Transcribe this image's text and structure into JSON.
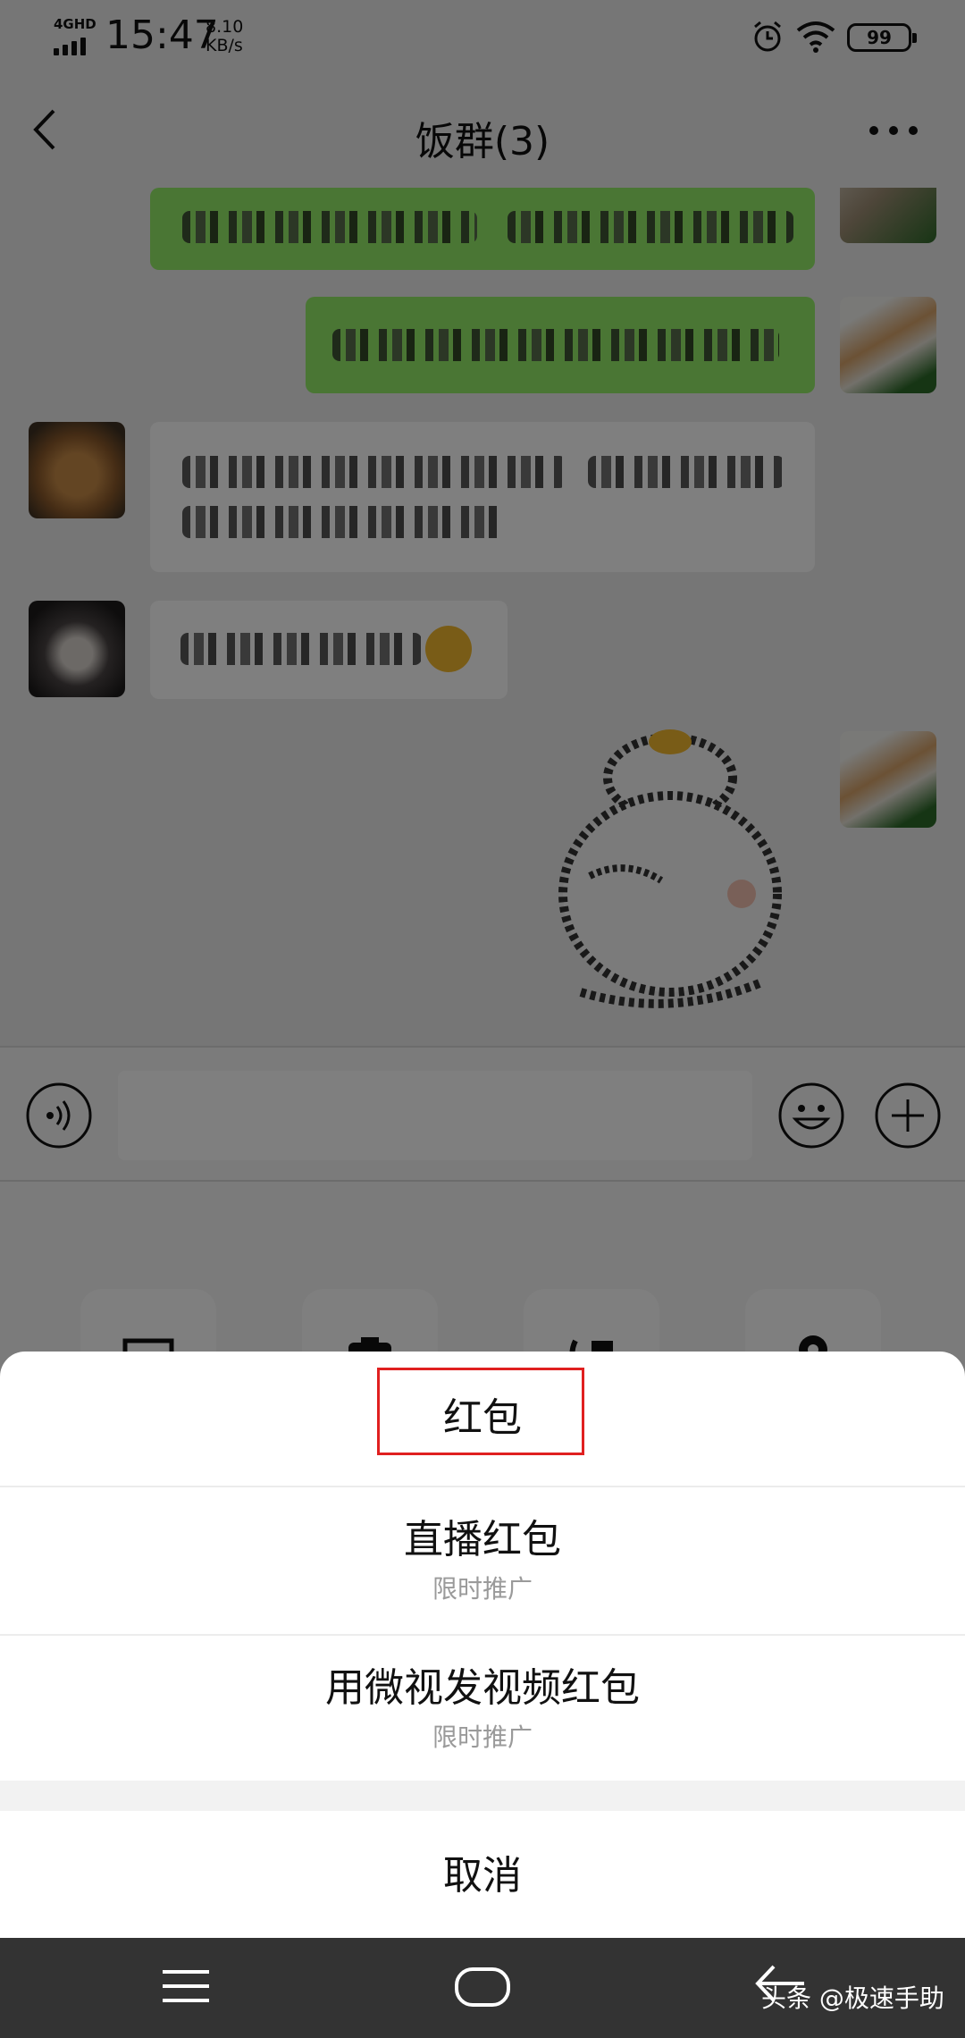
{
  "status_bar": {
    "network": "4GHD",
    "time": "15:47",
    "speed_value": "8.10",
    "speed_unit": "KB/s",
    "battery": "99"
  },
  "header": {
    "title": "饭群(3)",
    "back_icon": "chevron-left-icon",
    "more_icon": "more-dots-icon"
  },
  "chat": {
    "messages": [
      {
        "side": "right",
        "type": "text",
        "content_state": "pixelated"
      },
      {
        "side": "right",
        "type": "text",
        "content_state": "pixelated"
      },
      {
        "side": "left",
        "type": "text",
        "content_state": "pixelated"
      },
      {
        "side": "left",
        "type": "text",
        "content_state": "pixelated"
      },
      {
        "side": "right",
        "type": "sticker",
        "content_state": "pixelated"
      }
    ]
  },
  "input_bar": {
    "voice_icon": "voice-icon",
    "emoji_icon": "emoji-icon",
    "plus_icon": "plus-icon",
    "input_value": ""
  },
  "plus_panel": {
    "icons": [
      "image-icon",
      "camera-icon",
      "video-call-icon",
      "location-icon"
    ]
  },
  "action_sheet": {
    "items": [
      {
        "label": "红包",
        "sublabel": ""
      },
      {
        "label": "直播红包",
        "sublabel": "限时推广"
      },
      {
        "label": "用微视发视频红包",
        "sublabel": "限时推广"
      }
    ],
    "cancel_label": "取消"
  },
  "nav_bar": {
    "watermark": "头条 @极速手助"
  },
  "colors": {
    "bubble_green": "#95ec69",
    "highlight_red": "#e02020",
    "nav_bg": "#333333"
  }
}
